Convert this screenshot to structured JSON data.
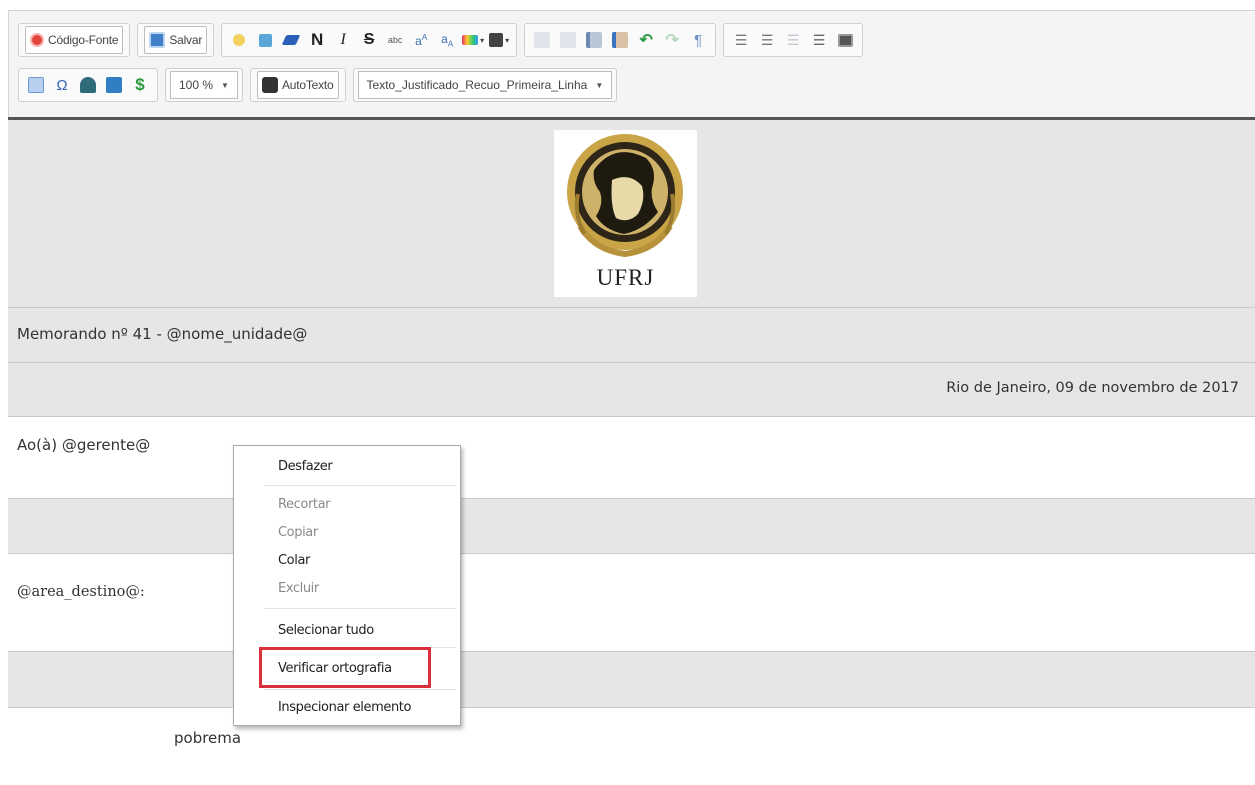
{
  "toolbar": {
    "source_label": "Código-Fonte",
    "save_label": "Salvar",
    "bold_glyph": "N",
    "italic_glyph": "I",
    "strike_glyph": "S",
    "abc_glyph": "abc",
    "zoom_value": "100 %",
    "autotext_label": "AutoTexto",
    "style_value": "Texto_Justificado_Recuo_Primeira_Linha"
  },
  "document": {
    "logo_text": "UFRJ",
    "memo_title": "Memorando nº 41 - @nome_unidade@",
    "date_line": "Rio de Janeiro, 09 de novembro de 2017",
    "addressee": "Ao(à) @gerente@",
    "area_destino": "@area_destino@:",
    "body_word": "pobrema"
  },
  "context_menu": {
    "items": [
      {
        "label": "Desfazer",
        "enabled": true
      },
      {
        "label": "Recortar",
        "enabled": false
      },
      {
        "label": "Copiar",
        "enabled": false
      },
      {
        "label": "Colar",
        "enabled": true
      },
      {
        "label": "Excluir",
        "enabled": false
      },
      {
        "label": "Selecionar tudo",
        "enabled": true
      },
      {
        "label": "Verificar ortografia",
        "enabled": true,
        "highlighted": true
      },
      {
        "label": "Inspecionar elemento",
        "enabled": true
      }
    ]
  },
  "colors": {
    "highlight_border": "#d9303e",
    "grey_row": "#e6e6e6",
    "toolbar_bg": "#f4f4f4"
  }
}
